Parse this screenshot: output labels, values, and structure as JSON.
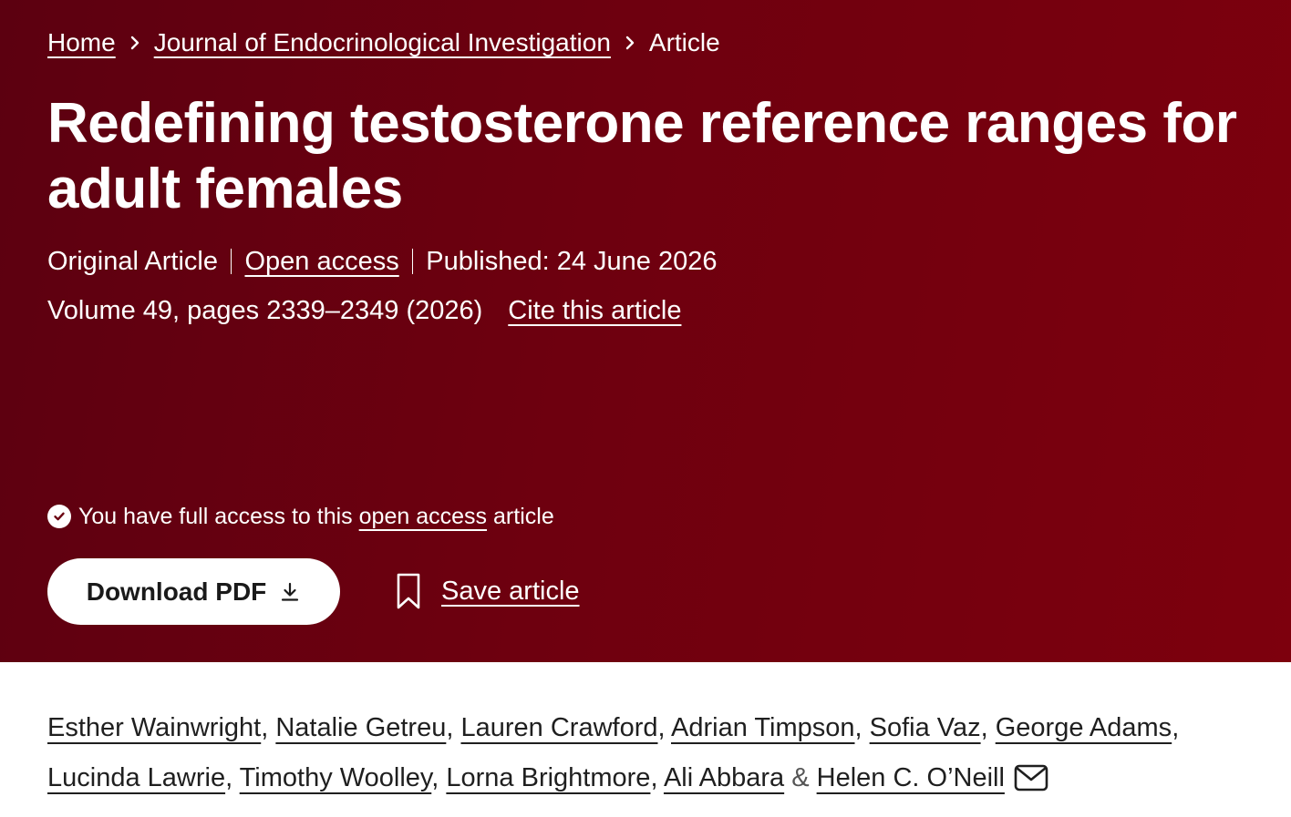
{
  "breadcrumb": {
    "items": [
      "Home",
      "Journal of Endocrinological Investigation"
    ],
    "current": "Article"
  },
  "article": {
    "title": "Redefining testosterone reference ranges for adult females",
    "type": "Original Article",
    "access_label": "Open access",
    "published": "Published: 24 June 2026",
    "volume_pages": "Volume 49, pages 2339–2349 (2026)",
    "cite_label": "Cite this article"
  },
  "access_notice": {
    "prefix": "You have full access to this",
    "link": "open access",
    "suffix": "article"
  },
  "actions": {
    "download_label": "Download PDF",
    "save_label": "Save article"
  },
  "authors": [
    {
      "name": "Esther Wainwright",
      "sep": ", "
    },
    {
      "name": "Natalie Getreu",
      "sep": ", "
    },
    {
      "name": "Lauren Crawford",
      "sep": ", "
    },
    {
      "name": "Adrian Timpson",
      "sep": ", "
    },
    {
      "name": "Sofia Vaz",
      "sep": ", "
    },
    {
      "name": "George Adams",
      "sep": ", "
    },
    {
      "name": "Lucinda Lawrie",
      "sep": ", "
    },
    {
      "name": "Timothy Woolley",
      "sep": ", "
    },
    {
      "name": "Lorna Brightmore",
      "sep": ", "
    },
    {
      "name": "Ali Abbara",
      "sep": " & "
    },
    {
      "name": "Helen C. O’Neill",
      "sep": ""
    }
  ],
  "icons": {
    "chevron": "chevron-right-icon",
    "check": "check-circle-icon",
    "download": "download-icon",
    "bookmark": "bookmark-icon",
    "mail": "mail-icon"
  },
  "colors": {
    "hero_start": "#5c0010",
    "hero_end": "#7d000d",
    "text_light": "#ffffff",
    "text_dark": "#1f1f1f"
  }
}
